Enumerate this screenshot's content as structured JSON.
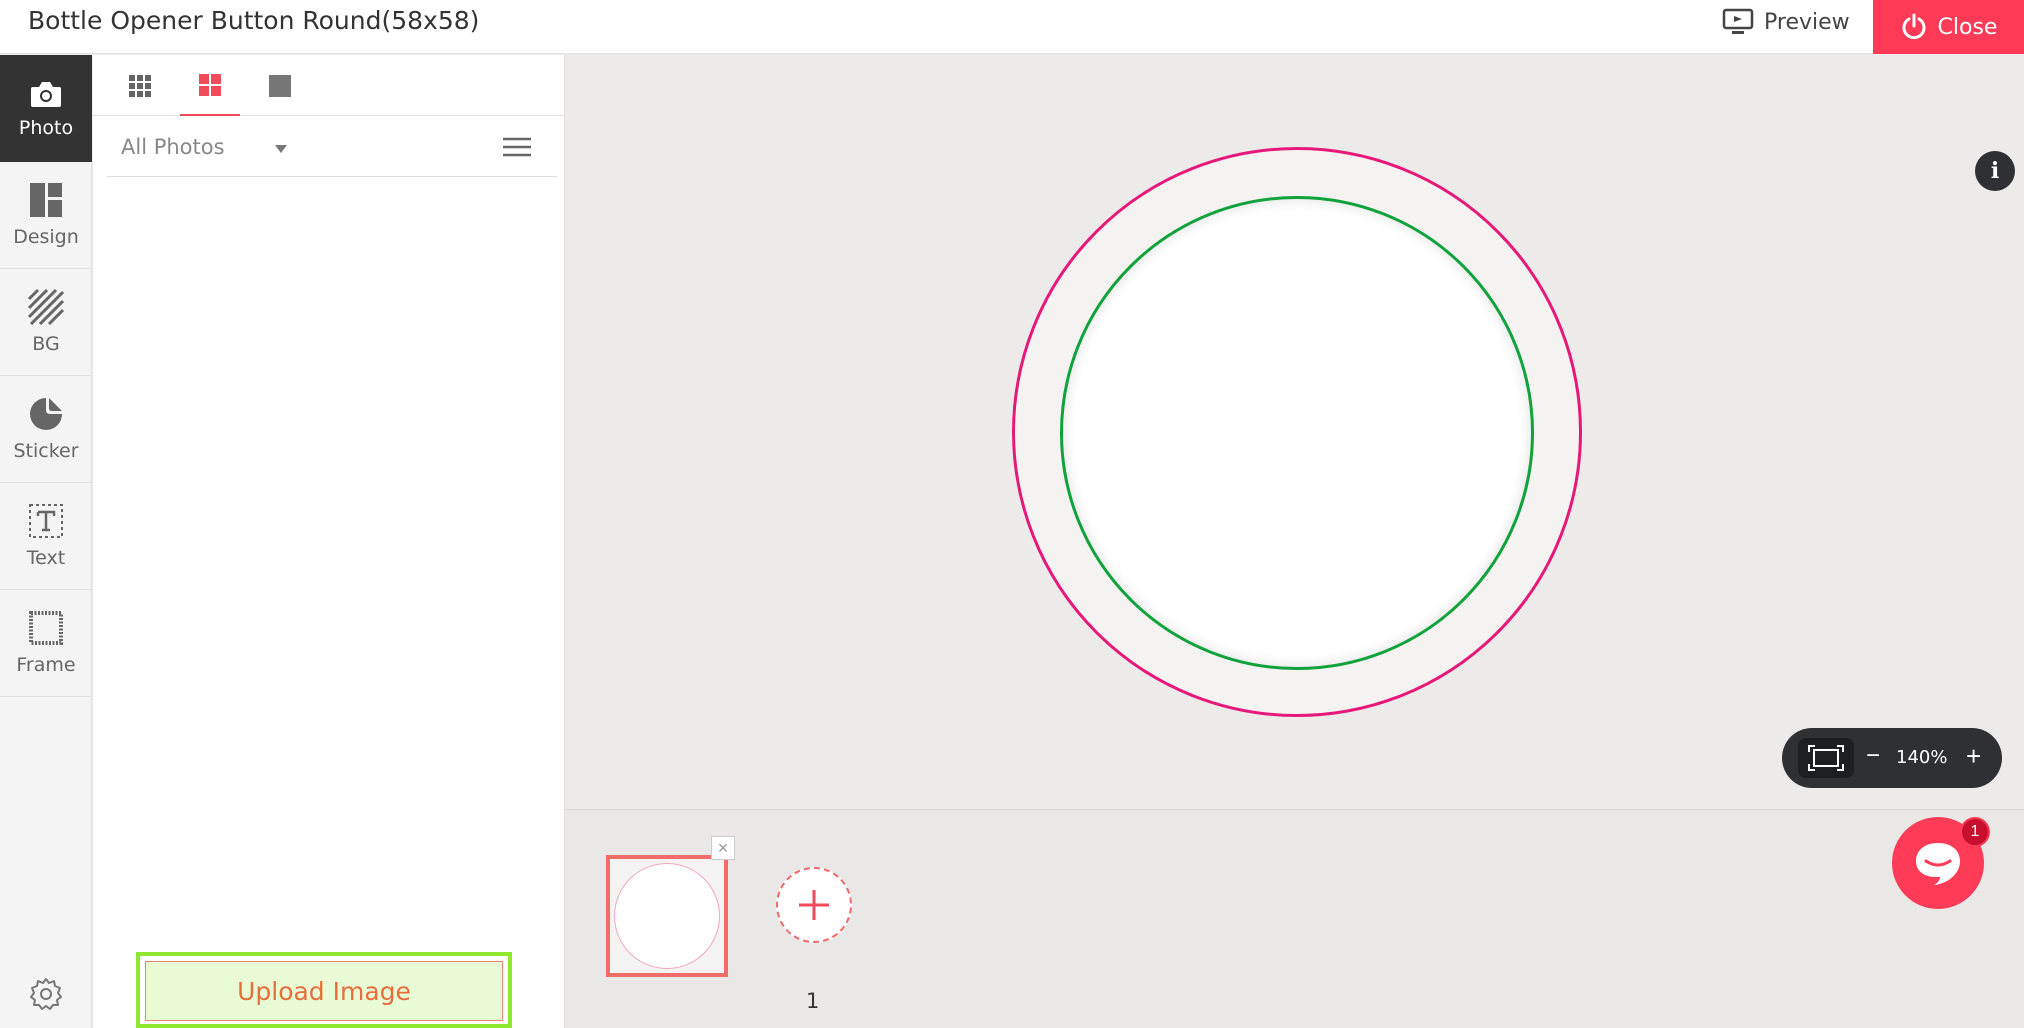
{
  "header": {
    "title": "Bottle Opener Button Round(58x58)",
    "preview_label": "Preview",
    "close_label": "Close"
  },
  "rail": {
    "items": [
      {
        "label": "Photo",
        "icon": "camera-icon",
        "active": true
      },
      {
        "label": "Design",
        "icon": "layout-icon"
      },
      {
        "label": "BG",
        "icon": "hatch-icon"
      },
      {
        "label": "Sticker",
        "icon": "sticker-icon"
      },
      {
        "label": "Text",
        "icon": "text-frame-icon"
      },
      {
        "label": "Frame",
        "icon": "frame-icon"
      }
    ],
    "settings_icon": "gear-icon"
  },
  "panel": {
    "view_tabs": [
      "grid-small-icon",
      "grid-large-icon",
      "single-view-icon"
    ],
    "active_view": 1,
    "filter_value": "All Photos",
    "upload_label": "Upload Image"
  },
  "canvas": {
    "info_label": "i",
    "zoom": {
      "value": "140%",
      "minus": "−",
      "plus": "+"
    },
    "outer_ring_color": "#e6197a",
    "inner_ring_color": "#10a23b"
  },
  "pages": {
    "page_number": "1",
    "remove_label": "×",
    "chat_badge": "1"
  },
  "colors": {
    "accent": "#ff3a57",
    "upload_border": "#8ee82e"
  }
}
